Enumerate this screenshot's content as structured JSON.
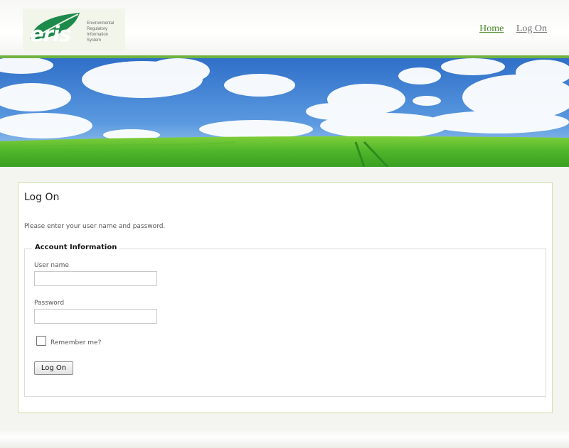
{
  "header": {
    "logo": {
      "word": "eris",
      "lines": [
        "Environmental",
        "Regulatory",
        "Information",
        "System"
      ]
    },
    "nav": [
      {
        "label": "Home",
        "active": true
      },
      {
        "label": "Log On",
        "active": false
      }
    ]
  },
  "colors": {
    "accent_green": "#6fb341",
    "link_active": "#4f8a2b",
    "link": "#707070"
  },
  "main": {
    "title": "Log On",
    "instructions": "Please enter your user name and password.",
    "account": {
      "legend": "Account Information",
      "username_label": "User name",
      "username_value": "",
      "password_label": "Password",
      "password_value": "",
      "remember_label": "Remember me?",
      "remember_checked": false,
      "submit_label": "Log On"
    }
  }
}
